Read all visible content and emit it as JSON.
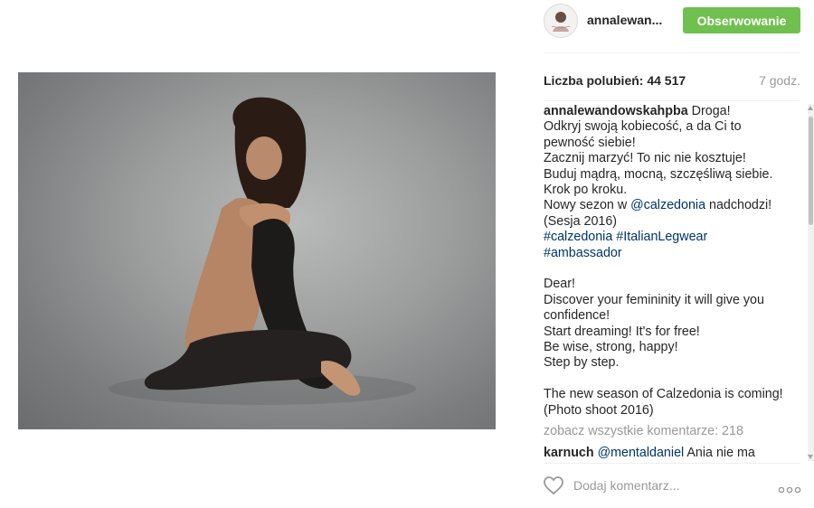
{
  "post": {
    "image_alt": "",
    "author": "annalewan...",
    "follow_label": "Obserwowanie",
    "likes_label": "Liczba polubień:",
    "likes_count": "44 517",
    "time_ago": "7 godz."
  },
  "caption": {
    "username": "annalewandowskahpba",
    "lines": [
      " Droga!",
      "Odkryj swoją kobiecość, a da Ci to",
      "pewność siebie!",
      "Zacznij marzyć! To nic nie kosztuje!",
      "Buduj mądrą, mocną, szczęśliwą siebie.",
      "Krok po kroku.",
      "Nowy sezon w "
    ],
    "mention": "@calzedonia",
    "mention_tail": " nadchodzi!",
    "line_after_mention": "(Sesja 2016)",
    "hashtag1": "#calzedonia",
    "hashtag2": "#ItalianLegwear",
    "hashtag3": "#ambassador",
    "english_lines": [
      "Dear!",
      "Discover your femininity it will give you",
      "confidence!",
      "Start dreaming! It's for free!",
      "Be wise, strong, happy!",
      "Step by step."
    ],
    "english_lines2": [
      "The new season of Calzedonia is coming!",
      "(Photo shoot 2016)"
    ]
  },
  "comments": {
    "view_all": "zobacz wszystkie komentarze: 218",
    "first_user": "karnuch",
    "first_mention": "@mentaldaniel",
    "first_text": " Ania nie ma"
  },
  "footer": {
    "comment_placeholder": "Dodaj komentarz...",
    "like_icon": "heart-icon",
    "more_icon": "ellipsis-icon"
  },
  "colors": {
    "follow_button": "#70c050",
    "link": "#003569",
    "muted": "#999999"
  }
}
